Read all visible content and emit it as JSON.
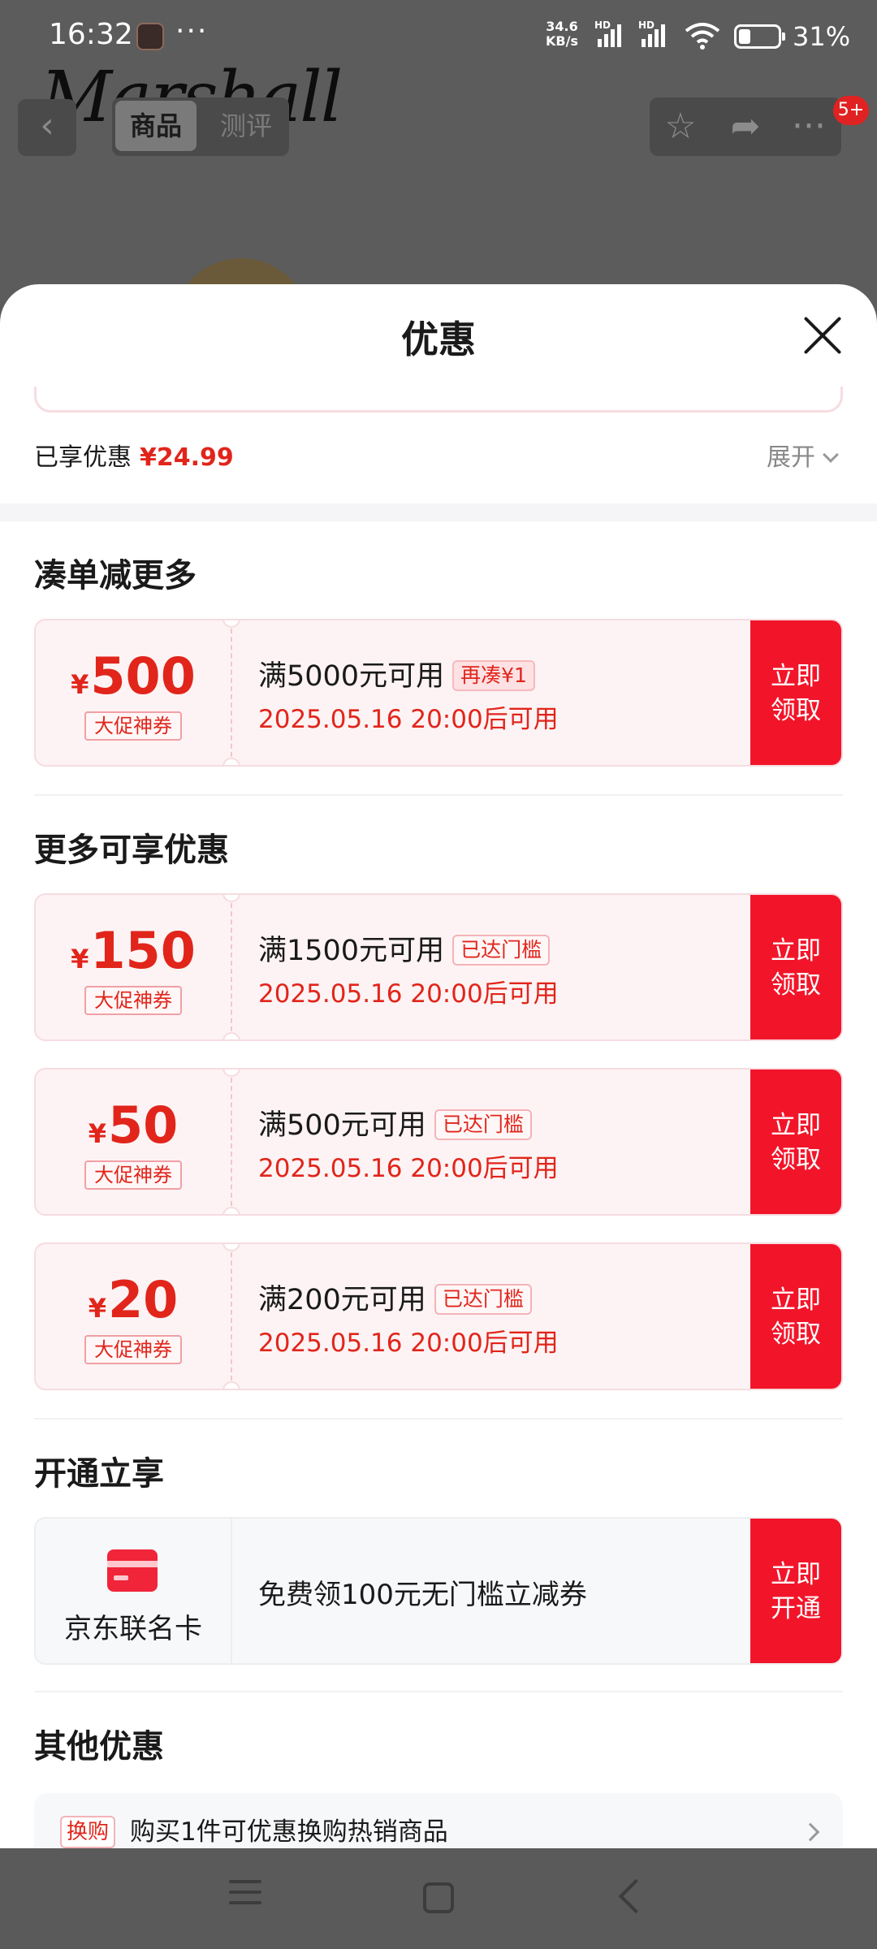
{
  "status_bar": {
    "time": "16:32",
    "dots": "···",
    "speed_value": "34.6",
    "speed_unit": "KB/s",
    "network_hd_1": "HD",
    "network_hd_2": "HD",
    "battery_level": 0.31,
    "battery_percent": "31%"
  },
  "background_page": {
    "brand_logo_text": "Marshall",
    "tab_product": "商品",
    "tab_review": "测评",
    "cart_badge": "5+",
    "icons": [
      "back-icon",
      "star-icon",
      "share-icon",
      "more-icon"
    ]
  },
  "sheet": {
    "title": "优惠",
    "enjoyed_label": "已享优惠",
    "enjoyed_amount": "¥24.99",
    "expand_label": "展开",
    "sections": {
      "combine": "凑单减更多",
      "more": "更多可享优惠",
      "open": "开通立享",
      "other": "其他优惠"
    },
    "combine_coupon": {
      "yen": "¥",
      "amount": "500",
      "tag": "大促神券",
      "condition": "满5000元可用",
      "chip": "再凑¥1",
      "time": "2025.05.16 20:00后可用",
      "button_line1": "立即",
      "button_line2": "领取"
    },
    "more_coupons": [
      {
        "yen": "¥",
        "amount": "150",
        "tag": "大促神券",
        "condition": "满1500元可用",
        "chip": "已达门槛",
        "time": "2025.05.16 20:00后可用",
        "button_line1": "立即",
        "button_line2": "领取"
      },
      {
        "yen": "¥",
        "amount": "50",
        "tag": "大促神券",
        "condition": "满500元可用",
        "chip": "已达门槛",
        "time": "2025.05.16 20:00后可用",
        "button_line1": "立即",
        "button_line2": "领取"
      },
      {
        "yen": "¥",
        "amount": "20",
        "tag": "大促神券",
        "condition": "满200元可用",
        "chip": "已达门槛",
        "time": "2025.05.16 20:00后可用",
        "button_line1": "立即",
        "button_line2": "领取"
      }
    ],
    "member_card": {
      "icon": "credit-card-icon",
      "name": "京东联名卡",
      "text": "免费领100元无门槛立减券",
      "button_line1": "立即",
      "button_line2": "开通"
    },
    "other_offer": {
      "chip": "换购",
      "text": "购买1件可优惠换购热销商品"
    }
  },
  "nav_bar": {
    "icons": [
      "menu-icon",
      "home-icon",
      "back-icon"
    ]
  },
  "colors": {
    "accent_red": "#e1251b",
    "button_red": "#f2152a",
    "coupon_bg": "#fdf3f4",
    "overlay_gray": "#5c5c5c"
  }
}
